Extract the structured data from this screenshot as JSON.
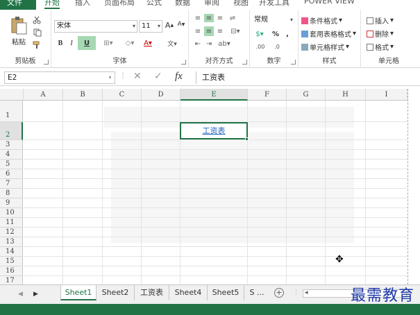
{
  "tabs": [
    {
      "label": "文件"
    },
    {
      "label": "开始"
    },
    {
      "label": "插入"
    },
    {
      "label": "页面布局"
    },
    {
      "label": "公式"
    },
    {
      "label": "数据"
    },
    {
      "label": "审阅"
    },
    {
      "label": "视图"
    },
    {
      "label": "开发工具"
    },
    {
      "label": "POWER VIEW"
    }
  ],
  "ribbon": {
    "clipboard": {
      "paste_label": "粘贴",
      "group_label": "剪贴板"
    },
    "font": {
      "font_name": "宋体",
      "font_size": "11",
      "group_label": "字体",
      "bold": "B",
      "italic": "I",
      "underline": "U"
    },
    "alignment": {
      "group_label": "对齐方式"
    },
    "number": {
      "format": "常规",
      "percent": "%",
      "comma": ",",
      "group_label": "数字"
    },
    "styles": {
      "conditional": "条件格式",
      "table_format": "套用表格格式",
      "cell_styles": "单元格样式",
      "group_label": "样式"
    },
    "cells": {
      "insert": "插入",
      "delete": "删除",
      "format": "格式",
      "group_label": "单元格"
    }
  },
  "formula_bar": {
    "name_box": "E2",
    "fx": "fx",
    "content": "工资表"
  },
  "grid": {
    "columns": [
      "A",
      "B",
      "C",
      "D",
      "E",
      "F",
      "G",
      "H",
      "I"
    ],
    "rows": [
      "1",
      "2",
      "3",
      "4",
      "5",
      "6",
      "7",
      "8",
      "9",
      "10",
      "11",
      "12",
      "13",
      "14",
      "15",
      "16",
      "17"
    ],
    "selected_column": "E",
    "selected_row": "2",
    "active_cell_value": "工资表"
  },
  "sheets": [
    {
      "label": "Sheet1",
      "active": true
    },
    {
      "label": "Sheet2"
    },
    {
      "label": "工资表"
    },
    {
      "label": "Sheet4"
    },
    {
      "label": "Sheet5"
    },
    {
      "label": "S ..."
    }
  ],
  "watermark": "最需教育",
  "colors": {
    "accent": "#217346",
    "link": "#2266bb"
  }
}
